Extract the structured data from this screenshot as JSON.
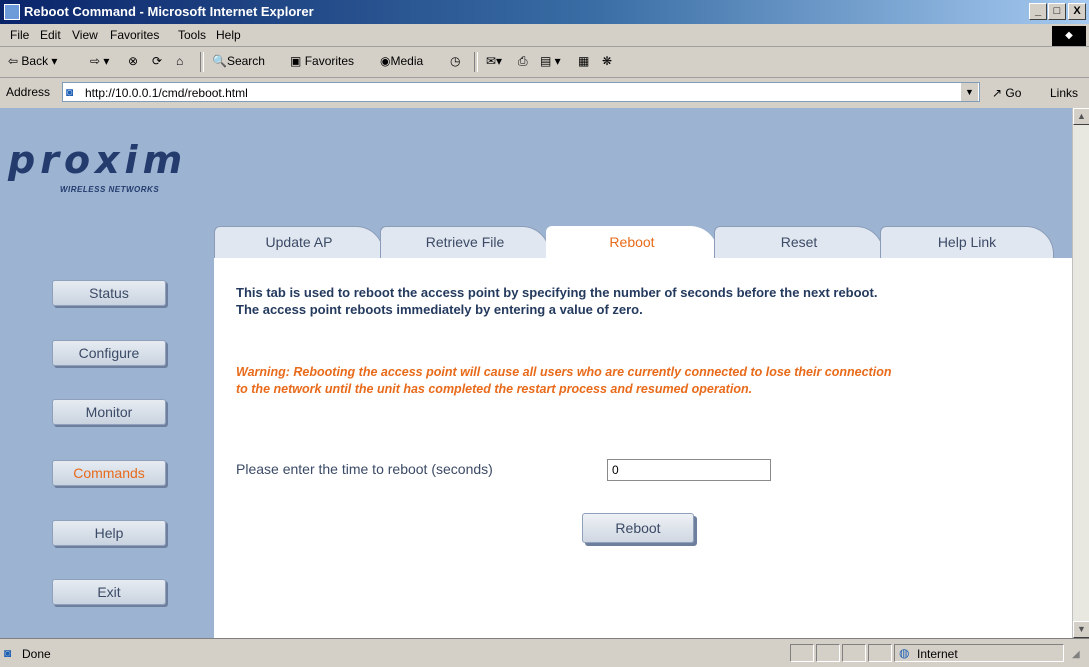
{
  "window": {
    "title": "Reboot Command - Microsoft Internet Explorer",
    "minimize": "_",
    "maximize": "□",
    "close": "X"
  },
  "menu": [
    "File",
    "Edit",
    "View",
    "Favorites",
    "Tools",
    "Help"
  ],
  "toolbar": {
    "back": "Back",
    "search": "Search",
    "favorites": "Favorites",
    "media": "Media"
  },
  "address": {
    "label": "Address",
    "url": "http://10.0.0.1/cmd/reboot.html",
    "go": "Go",
    "links": "Links"
  },
  "logo": {
    "text": "proxim",
    "subtext": "WIRELESS NETWORKS"
  },
  "tabs": [
    {
      "label": "Update AP",
      "active": false
    },
    {
      "label": "Retrieve File",
      "active": false
    },
    {
      "label": "Reboot",
      "active": true
    },
    {
      "label": "Reset",
      "active": false
    },
    {
      "label": "Help Link",
      "active": false
    }
  ],
  "sidebar": [
    {
      "label": "Status",
      "active": false
    },
    {
      "label": "Configure",
      "active": false
    },
    {
      "label": "Monitor",
      "active": false
    },
    {
      "label": "Commands",
      "active": true
    },
    {
      "label": "Help",
      "active": false
    },
    {
      "label": "Exit",
      "active": false
    }
  ],
  "content": {
    "description": "This tab is used to reboot the access point by specifying the number of seconds before the next reboot. The access point reboots immediately by entering a value of zero.",
    "warning": "Warning: Rebooting the access point will cause all users who are currently connected to lose their connection to the network until the unit has completed the restart process and resumed operation.",
    "prompt": "Please enter the time to reboot (seconds)",
    "time_value": "0",
    "reboot_button": "Reboot"
  },
  "status": {
    "text": "Done",
    "zone": "Internet"
  },
  "colors": {
    "page_bg": "#9cb3d2",
    "accent_orange": "#e86a1a",
    "text_navy": "#243a5e"
  }
}
